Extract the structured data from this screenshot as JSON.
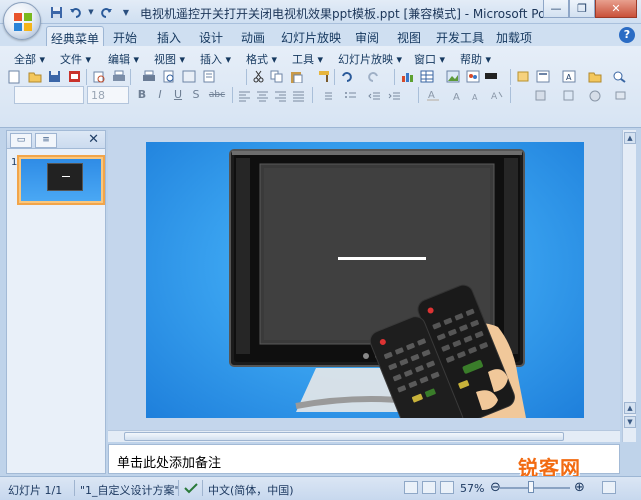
{
  "window": {
    "title": "电视机遥控开关打开关闭电视机效果ppt模板.ppt [兼容模式] - Microsoft PowerPoint"
  },
  "qat": {
    "icons": [
      "save-icon",
      "undo-icon",
      "redo-icon",
      "customize-icon"
    ]
  },
  "tabs": [
    "经典菜单",
    "开始",
    "插入",
    "设计",
    "动画",
    "幻灯片放映",
    "审阅",
    "视图",
    "开发工具",
    "加载项"
  ],
  "menu": [
    "全部",
    "文件",
    "编辑",
    "视图",
    "插入",
    "格式",
    "工具",
    "幻灯片放映",
    "窗口",
    "帮助"
  ],
  "font": {
    "name_value": "",
    "size_value": "18"
  },
  "format_buttons": {
    "bold": "B",
    "italic": "I",
    "underline": "U",
    "shadow": "S",
    "strike": "abc"
  },
  "slide_panel": {
    "slide_number": "1"
  },
  "notes": {
    "placeholder": "单击此处添加备注"
  },
  "statusbar": {
    "slide_info": "幻灯片 1/1",
    "theme": "\"1_自定义设计方案\"",
    "language": "中文(简体，中国)",
    "zoom": "57%"
  },
  "watermark": {
    "text": "锐客网"
  },
  "colors": {
    "slide_background": "#2a92ea",
    "active_thumbnail_border": "#f2a54a",
    "accent": "#1e395b"
  }
}
